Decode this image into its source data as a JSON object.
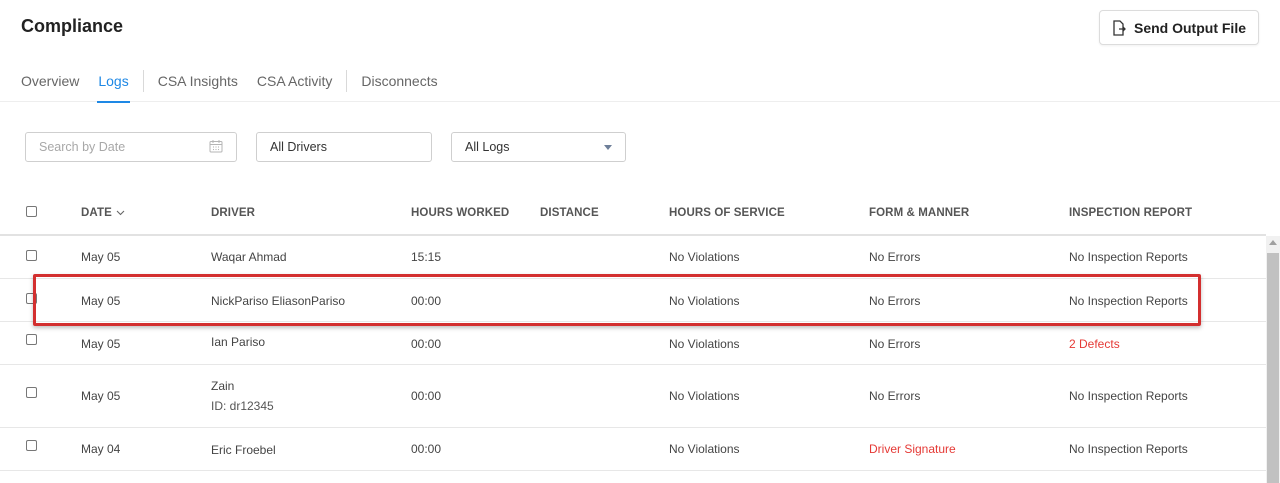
{
  "app": {
    "title": "Compliance",
    "send_button_label": "Send Output File"
  },
  "tabs": [
    {
      "label": "Overview",
      "active": false
    },
    {
      "label": "Logs",
      "active": true
    },
    {
      "label": "CSA Insights",
      "active": false
    },
    {
      "label": "CSA Activity",
      "active": false
    },
    {
      "label": "Disconnects",
      "active": false
    }
  ],
  "filters": {
    "date_placeholder": "Search by Date",
    "drivers_value": "All Drivers",
    "logs_value": "All Logs"
  },
  "table": {
    "columns": [
      "DATE",
      "DRIVER",
      "HOURS WORKED",
      "DISTANCE",
      "HOURS OF SERVICE",
      "FORM & MANNER",
      "INSPECTION REPORT"
    ],
    "rows": [
      {
        "date": "May 05",
        "driver": "Waqar Ahmad",
        "driver_id": "",
        "hours": "15:15",
        "distance": "",
        "hos": "No Violations",
        "form": "No Errors",
        "inspection": "No Inspection Reports"
      },
      {
        "date": "May 05",
        "driver": "NickPariso EliasonPariso",
        "driver_id": "",
        "hours": "00:00",
        "distance": "",
        "hos": "No Violations",
        "form": "No Errors",
        "inspection": "No Inspection Reports"
      },
      {
        "date": "May 05",
        "driver": "Ian Pariso",
        "driver_id": "",
        "hours": "00:00",
        "distance": "",
        "hos": "No Violations",
        "form": "No Errors",
        "inspection": "2 Defects"
      },
      {
        "date": "May 05",
        "driver": "Zain",
        "driver_id": "ID: dr12345",
        "hours": "00:00",
        "distance": "",
        "hos": "No Violations",
        "form": "No Errors",
        "inspection": "No Inspection Reports"
      },
      {
        "date": "May 04",
        "driver": "Eric Froebel",
        "driver_id": "",
        "hours": "00:00",
        "distance": "",
        "hos": "No Violations",
        "form": "Driver Signature",
        "inspection": "No Inspection Reports"
      }
    ]
  },
  "colors": {
    "accent": "#1e88e5",
    "alert": "#e53935",
    "highlight_box": "#d32f2f"
  },
  "icons": {
    "send": "file-export-icon",
    "calendar": "calendar-icon",
    "dropdown": "caret-down-icon",
    "sort": "chevron-down-icon"
  }
}
